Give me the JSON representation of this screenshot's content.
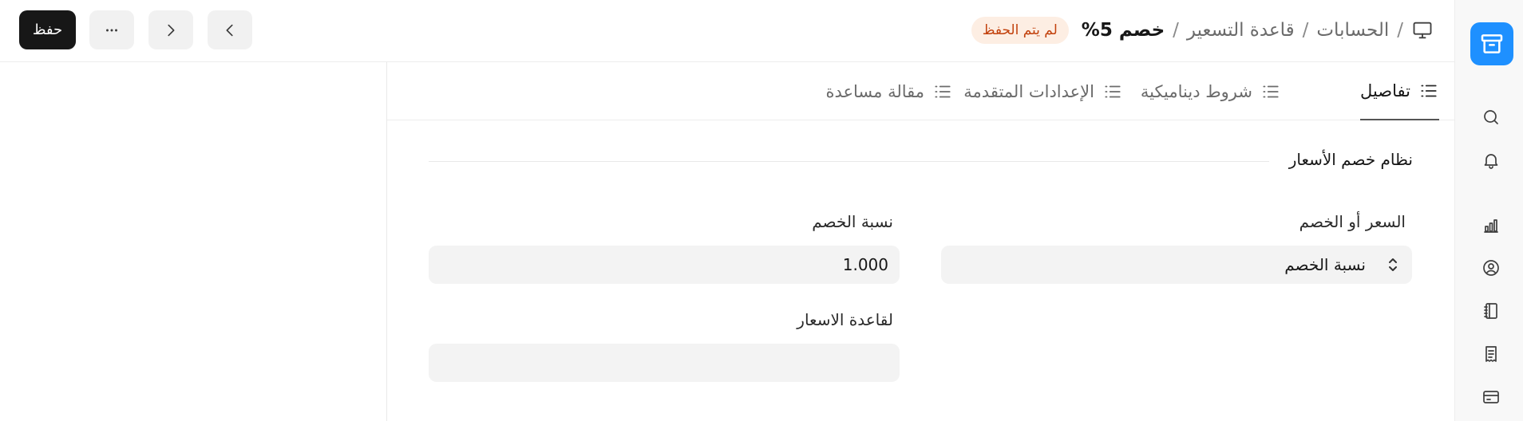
{
  "toolbar": {
    "save_label": "حفظ",
    "more_icon": "more-horizontal-icon",
    "next_icon": "chevron-right-icon",
    "prev_icon": "chevron-left-icon"
  },
  "breadcrumb": {
    "icon": "monitor-icon",
    "items": [
      "الحسابات",
      "قاعدة التسعير"
    ],
    "separator": "/",
    "current": "خصم 5%",
    "status_badge": "لم يتم الحفظ"
  },
  "tabs": [
    {
      "label": "تفاصيل",
      "icon": "list-icon",
      "active": true
    },
    {
      "label": "شروط ديناميكية",
      "icon": "list-icon",
      "active": false
    },
    {
      "label": "الإعدادات المتقدمة",
      "icon": "list-icon",
      "active": false
    },
    {
      "label": "مقالة مساعدة",
      "icon": "list-icon",
      "active": false
    }
  ],
  "section": {
    "title": "نظام خصم الأسعار"
  },
  "fields": {
    "price_or_discount": {
      "label": "السعر أو الخصم",
      "value": "نسبة الخصم"
    },
    "discount_percentage": {
      "label": "نسبة الخصم",
      "value": "1.000"
    },
    "for_price_rule": {
      "label": "لقاعدة الاسعار",
      "value": ""
    }
  },
  "sidebar": {
    "logo_icon": "app-logo-icon",
    "icons": [
      "search-icon",
      "bell-icon",
      "bar-chart-icon",
      "user-circle-icon",
      "notebook-icon",
      "receipt-icon",
      "card-icon"
    ]
  },
  "colors": {
    "accent": "#1e90ff",
    "badge_bg": "#fdeee3",
    "badge_text": "#c2410c",
    "primary_button": "#171717"
  }
}
